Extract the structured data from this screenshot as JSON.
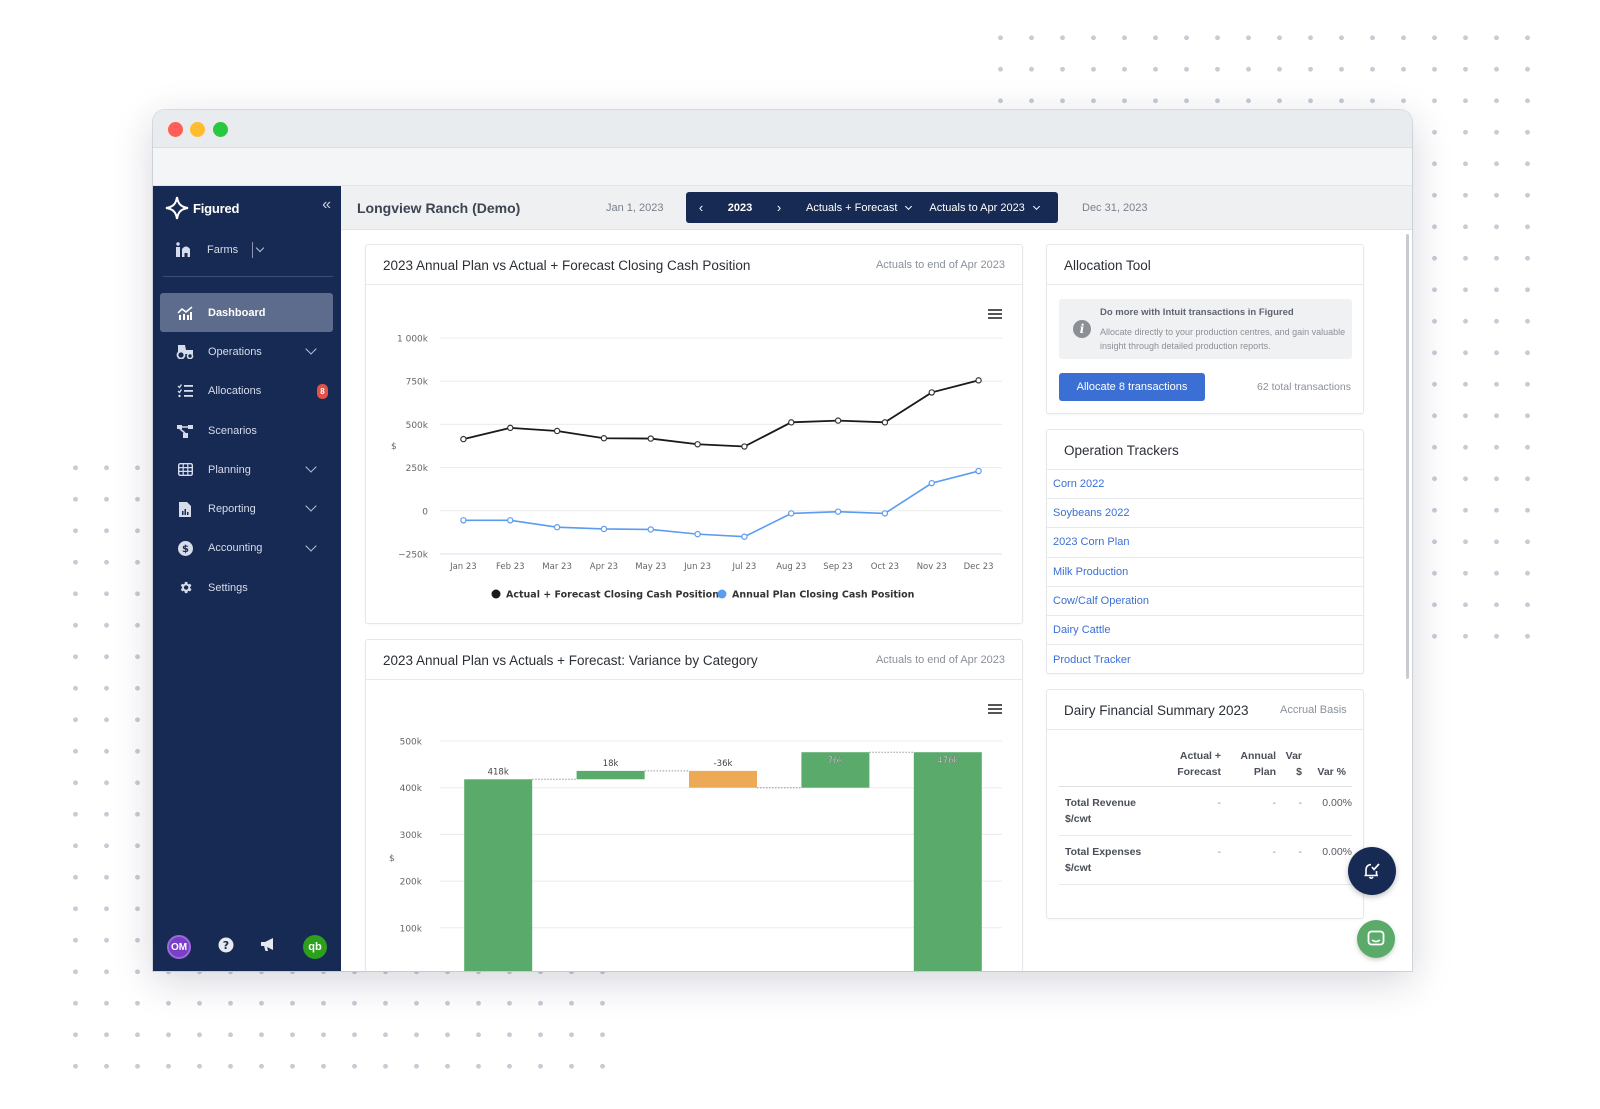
{
  "window": {
    "traffic_lights": {
      "close": "#ff5f57",
      "minimize": "#febc2e",
      "maximize": "#28c840"
    }
  },
  "colors": {
    "sidebar_bg": "#172a53",
    "accent_blue": "#3c6fd4",
    "series_black": "#1a1a1a",
    "series_blue": "#5b9bf0",
    "bar_positive": "#5aab6b",
    "bar_negative": "#edaa56",
    "badge_red": "#e0524a"
  },
  "sidebar": {
    "brand": "Figured",
    "collapse_icon": "double-chevron-left-icon",
    "farm_selector": {
      "label": "Farms",
      "icon": "farm-icon"
    },
    "items": [
      {
        "label": "Dashboard",
        "icon": "chart-icon",
        "active": true,
        "expandable": false
      },
      {
        "label": "Operations",
        "icon": "tractor-icon",
        "active": false,
        "expandable": true
      },
      {
        "label": "Allocations",
        "icon": "checklist-icon",
        "active": false,
        "expandable": false,
        "badge": "8"
      },
      {
        "label": "Scenarios",
        "icon": "scenarios-icon",
        "active": false,
        "expandable": false
      },
      {
        "label": "Planning",
        "icon": "grid-icon",
        "active": false,
        "expandable": true
      },
      {
        "label": "Reporting",
        "icon": "report-icon",
        "active": false,
        "expandable": true
      },
      {
        "label": "Accounting",
        "icon": "dollar-icon",
        "active": false,
        "expandable": true
      },
      {
        "label": "Settings",
        "icon": "gear-icon",
        "active": false,
        "expandable": false
      }
    ],
    "footer": {
      "avatar_initials": "OM",
      "help_icon": "help-icon",
      "announce_icon": "megaphone-icon",
      "qb_label": "qb"
    }
  },
  "topbar": {
    "farm_name": "Longview Ranch (Demo)",
    "start_date": "Jan 1, 2023",
    "end_date": "Dec 31, 2023",
    "year": "2023",
    "view_mode": "Actuals + Forecast",
    "actuals_to": "Actuals to Apr 2023"
  },
  "cash_card": {
    "title": "2023 Annual Plan vs Actual + Forecast Closing Cash Position",
    "subtitle": "Actuals to end of Apr 2023"
  },
  "variance_card": {
    "title": "2023 Annual Plan vs Actuals + Forecast: Variance by Category",
    "subtitle": "Actuals to end of Apr 2023"
  },
  "chart_data": [
    {
      "type": "line",
      "title": "2023 Annual Plan vs Actual + Forecast Closing Cash Position",
      "xlabel": "",
      "ylabel": "$",
      "ylim": [
        -250000,
        1000000
      ],
      "yticks": [
        -250000,
        0,
        250000,
        500000,
        750000,
        1000000
      ],
      "ytick_labels": [
        "−250k",
        "0",
        "250k",
        "500k",
        "750k",
        "1 000k"
      ],
      "categories": [
        "Jan 23",
        "Feb 23",
        "Mar 23",
        "Apr 23",
        "May 23",
        "Jun 23",
        "Jul 23",
        "Aug 23",
        "Sep 23",
        "Oct 23",
        "Nov 23",
        "Dec 23"
      ],
      "grid": true,
      "legend": "bottom",
      "series": [
        {
          "name": "Actual + Forecast Closing Cash Position",
          "color": "#1a1a1a",
          "values": [
            415000,
            480000,
            462000,
            420000,
            418000,
            385000,
            372000,
            512000,
            522000,
            512000,
            685000,
            755000
          ]
        },
        {
          "name": "Annual Plan Closing Cash Position",
          "color": "#5b9bf0",
          "values": [
            -55000,
            -55000,
            -95000,
            -105000,
            -108000,
            -135000,
            -150000,
            -15000,
            -5000,
            -15000,
            160000,
            230000
          ]
        }
      ]
    },
    {
      "type": "bar",
      "subtype": "waterfall",
      "title": "2023 Annual Plan vs Actuals + Forecast: Variance by Category",
      "xlabel": "",
      "ylabel": "$",
      "ylim": [
        0,
        500000
      ],
      "yticks": [
        100000,
        200000,
        300000,
        400000,
        500000
      ],
      "ytick_labels": [
        "100k",
        "200k",
        "300k",
        "400k",
        "500k"
      ],
      "grid": true,
      "steps": [
        {
          "label": "418k",
          "value": 418000,
          "kind": "start"
        },
        {
          "label": "18k",
          "value": 18000,
          "kind": "delta"
        },
        {
          "label": "-36k",
          "value": -36000,
          "kind": "delta"
        },
        {
          "label": "76k",
          "value": 76000,
          "kind": "delta"
        },
        {
          "label": "476k",
          "value": 476000,
          "kind": "total"
        }
      ]
    }
  ],
  "allocation_tool": {
    "title": "Allocation Tool",
    "info_title": "Do more with Intuit transactions in Figured",
    "info_body": "Allocate directly to your production centres, and gain valuable insight through detailed production reports.",
    "button_label": "Allocate 8 transactions",
    "total_label": "62 total transactions"
  },
  "operation_trackers": {
    "title": "Operation Trackers",
    "items": [
      "Corn 2022",
      "Soybeans 2022",
      "2023 Corn Plan",
      "Milk Production",
      "Cow/Calf Operation",
      "Dairy Cattle",
      "Product Tracker"
    ]
  },
  "dairy_summary": {
    "title": "Dairy Financial Summary 2023",
    "basis": "Accrual Basis",
    "columns": [
      "",
      "Actual + Forecast",
      "Annual Plan",
      "Var $",
      "Var %"
    ],
    "rows": [
      {
        "label": "Total Revenue $/cwt",
        "actual": "-",
        "plan": "-",
        "var": "-",
        "var_pct": "0.00%"
      },
      {
        "label": "Total Expenses $/cwt",
        "actual": "-",
        "plan": "-",
        "var": "-",
        "var_pct": "0.00%"
      }
    ]
  }
}
